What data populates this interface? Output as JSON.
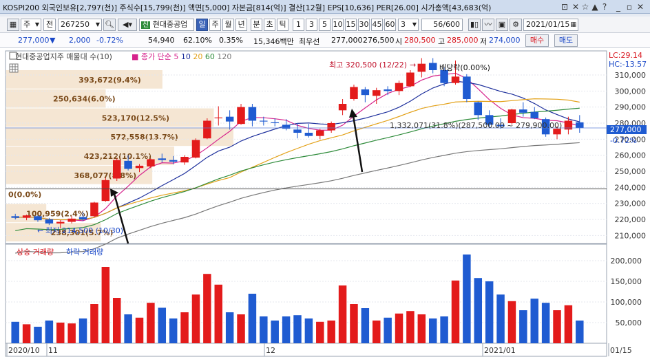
{
  "titlebar": {
    "text": "KOSPI200 외국인보유[2,797(천)] 주식수[15,799(천)] 액면[5,000] 자본금[814(억)] 결산[12월] EPS[10,636] PER[26.00] 시가총액[43,683(억)",
    "icons": [
      "lock-icon",
      "close-icon",
      "star-icon",
      "triangle-up-icon",
      "help-icon",
      "minimize-icon",
      "restore-icon",
      "close-window-icon"
    ]
  },
  "toolbar": {
    "market_select": "주",
    "market_kind": "전",
    "code": "267250",
    "company": "현대중공업",
    "periods": [
      "일",
      "주",
      "월",
      "년",
      "분",
      "초",
      "틱"
    ],
    "active_period": "일",
    "intervals": [
      "1",
      "3",
      "5",
      "10",
      "15",
      "30",
      "45",
      "60"
    ],
    "interval_value": "3",
    "count": "56/600",
    "date": "2021/01/15"
  },
  "quote": {
    "price": "277,000",
    "direction": "▼",
    "change": "2,000",
    "change_pct": "-0.72%",
    "volume": "54,940",
    "ratio": "62.10%",
    "rate2": "0.35%",
    "amount": "15,346백만",
    "best_bid_label": "최우선",
    "best_ask": "277,000",
    "best_bid": "276,500",
    "open_label": "시",
    "open": "280,500",
    "high_label": "고",
    "high": "285,000",
    "low_label": "저",
    "low": "274,000",
    "buy_label": "매수",
    "sell_label": "매도"
  },
  "price_panel": {
    "legend_title": "현대중공업지주 매물대 수(10)",
    "ma_label": "종가 단순",
    "ma_periods": [
      "5",
      "10",
      "20",
      "60",
      "120"
    ],
    "ma_colors": [
      "#d6238c",
      "#1d2f9c",
      "#e3a21a",
      "#2e8b3a",
      "#777777"
    ],
    "lc_label": "LC:29.14",
    "hc_label": "HC:-13.57",
    "current_price_label": "277,000",
    "current_pct_label": "-0.72%",
    "high_annotation": "최고 320,500 (12/22)",
    "low_annotation": "최저 214,500 (10/30)",
    "dividend_annotation": "배당락(0.00%)",
    "range_annotation": "1,332,071(31.8%)(287,500.00 ~ 279,900.00)",
    "volume_profile": [
      {
        "label": "393,672(9.4%)",
        "value": 393672
      },
      {
        "label": "250,634(6.0%)",
        "value": 250634
      },
      {
        "label": "523,170(12.5%)",
        "value": 523170
      },
      {
        "label": "572,558(13.7%)",
        "value": 572558
      },
      {
        "label": "423,212(10.1%)",
        "value": 423212
      },
      {
        "label": "368,077(8.8%)",
        "value": 368077
      },
      {
        "label": "0(0.0%)",
        "value": 0
      },
      {
        "label": "100,959(2.4%)",
        "value": 100959
      },
      {
        "label": "238,301(5.7%)",
        "value": 238301
      }
    ]
  },
  "volume_panel": {
    "up_label": "상승 거래량",
    "down_label": "하락 거래량"
  },
  "colors": {
    "up": "#e31b1b",
    "down": "#1f5bd1",
    "profile": "#f5e6d3",
    "accent": "#3a63b8"
  },
  "chart_data": {
    "type": "candlestick",
    "price_axis": {
      "ticks": [
        210000,
        220000,
        230000,
        240000,
        250000,
        260000,
        270000,
        280000,
        290000,
        300000,
        310000
      ],
      "ylim": [
        205000,
        325000
      ]
    },
    "volume_axis": {
      "ticks": [
        50000,
        100000,
        150000,
        200000
      ],
      "ylim": [
        0,
        230000
      ]
    },
    "x_labels": [
      "2020/10",
      "11",
      "12",
      "2021/01",
      "01/15"
    ],
    "candles": [
      {
        "o": 222000,
        "h": 223500,
        "l": 220000,
        "c": 221000,
        "v": 52000
      },
      {
        "o": 221000,
        "h": 223000,
        "l": 219500,
        "c": 222500,
        "v": 46000
      },
      {
        "o": 222000,
        "h": 222500,
        "l": 218500,
        "c": 219500,
        "v": 40000
      },
      {
        "o": 220000,
        "h": 221000,
        "l": 216500,
        "c": 217500,
        "v": 55000
      },
      {
        "o": 217500,
        "h": 219500,
        "l": 214500,
        "c": 218500,
        "v": 50000
      },
      {
        "o": 218500,
        "h": 222000,
        "l": 217500,
        "c": 220500,
        "v": 48000
      },
      {
        "o": 221500,
        "h": 224500,
        "l": 219000,
        "c": 220000,
        "v": 60000
      },
      {
        "o": 222000,
        "h": 231000,
        "l": 221500,
        "c": 230500,
        "v": 95000
      },
      {
        "o": 231500,
        "h": 246000,
        "l": 231000,
        "c": 244500,
        "v": 185000
      },
      {
        "o": 245500,
        "h": 258000,
        "l": 244000,
        "c": 257000,
        "v": 110000
      },
      {
        "o": 256500,
        "h": 260000,
        "l": 250500,
        "c": 251500,
        "v": 70000
      },
      {
        "o": 252000,
        "h": 254500,
        "l": 249500,
        "c": 253500,
        "v": 62000
      },
      {
        "o": 253000,
        "h": 258000,
        "l": 252000,
        "c": 257500,
        "v": 98000
      },
      {
        "o": 258000,
        "h": 261000,
        "l": 255500,
        "c": 257000,
        "v": 86000
      },
      {
        "o": 257000,
        "h": 259500,
        "l": 254500,
        "c": 256000,
        "v": 60000
      },
      {
        "o": 255500,
        "h": 260000,
        "l": 254000,
        "c": 259000,
        "v": 75000
      },
      {
        "o": 258500,
        "h": 270500,
        "l": 258000,
        "c": 269500,
        "v": 118000
      },
      {
        "o": 270500,
        "h": 283000,
        "l": 270000,
        "c": 281500,
        "v": 168000
      },
      {
        "o": 283000,
        "h": 290500,
        "l": 278500,
        "c": 283500,
        "v": 142000
      },
      {
        "o": 284000,
        "h": 288000,
        "l": 276000,
        "c": 281000,
        "v": 75000
      },
      {
        "o": 279500,
        "h": 292000,
        "l": 279000,
        "c": 290000,
        "v": 70000
      },
      {
        "o": 290000,
        "h": 292000,
        "l": 278000,
        "c": 281500,
        "v": 120000
      },
      {
        "o": 281500,
        "h": 284000,
        "l": 278500,
        "c": 281000,
        "v": 65000
      },
      {
        "o": 280500,
        "h": 283000,
        "l": 278000,
        "c": 280000,
        "v": 55000
      },
      {
        "o": 279000,
        "h": 282500,
        "l": 275500,
        "c": 276500,
        "v": 65000
      },
      {
        "o": 276000,
        "h": 280000,
        "l": 270500,
        "c": 274000,
        "v": 68000
      },
      {
        "o": 274000,
        "h": 279500,
        "l": 271000,
        "c": 272000,
        "v": 60000
      },
      {
        "o": 272000,
        "h": 276500,
        "l": 270000,
        "c": 275500,
        "v": 52000
      },
      {
        "o": 275500,
        "h": 281000,
        "l": 274000,
        "c": 280000,
        "v": 55000
      },
      {
        "o": 288000,
        "h": 295000,
        "l": 285000,
        "c": 292000,
        "v": 140000
      },
      {
        "o": 295000,
        "h": 304000,
        "l": 294000,
        "c": 302500,
        "v": 95000
      },
      {
        "o": 301000,
        "h": 302500,
        "l": 293000,
        "c": 297500,
        "v": 85000
      },
      {
        "o": 297000,
        "h": 302000,
        "l": 292000,
        "c": 300500,
        "v": 55000
      },
      {
        "o": 301000,
        "h": 303000,
        "l": 297500,
        "c": 300000,
        "v": 62000
      },
      {
        "o": 300000,
        "h": 306500,
        "l": 297500,
        "c": 305000,
        "v": 72000
      },
      {
        "o": 303000,
        "h": 313000,
        "l": 302500,
        "c": 311500,
        "v": 78000
      },
      {
        "o": 312000,
        "h": 320500,
        "l": 308500,
        "c": 317000,
        "v": 70000
      },
      {
        "o": 317500,
        "h": 320500,
        "l": 311000,
        "c": 313000,
        "v": 60000
      },
      {
        "o": 313000,
        "h": 314500,
        "l": 303000,
        "c": 305000,
        "v": 65000
      },
      {
        "o": 305000,
        "h": 319000,
        "l": 304000,
        "c": 309000,
        "v": 152000
      },
      {
        "o": 309000,
        "h": 310500,
        "l": 293000,
        "c": 295000,
        "v": 215000
      },
      {
        "o": 293000,
        "h": 293500,
        "l": 282000,
        "c": 285000,
        "v": 158000
      },
      {
        "o": 285000,
        "h": 288000,
        "l": 277000,
        "c": 279000,
        "v": 150000
      },
      {
        "o": 279000,
        "h": 283000,
        "l": 276500,
        "c": 278000,
        "v": 118000
      },
      {
        "o": 280000,
        "h": 289000,
        "l": 279000,
        "c": 288500,
        "v": 102000
      },
      {
        "o": 288500,
        "h": 293000,
        "l": 284000,
        "c": 286500,
        "v": 80000
      },
      {
        "o": 287000,
        "h": 290000,
        "l": 282500,
        "c": 283000,
        "v": 108000
      },
      {
        "o": 282500,
        "h": 283500,
        "l": 271500,
        "c": 273000,
        "v": 98000
      },
      {
        "o": 273000,
        "h": 278000,
        "l": 270000,
        "c": 276500,
        "v": 80000
      },
      {
        "o": 276000,
        "h": 284000,
        "l": 273000,
        "c": 281500,
        "v": 92000
      },
      {
        "o": 280500,
        "h": 285000,
        "l": 274000,
        "c": 277000,
        "v": 54940
      }
    ]
  }
}
